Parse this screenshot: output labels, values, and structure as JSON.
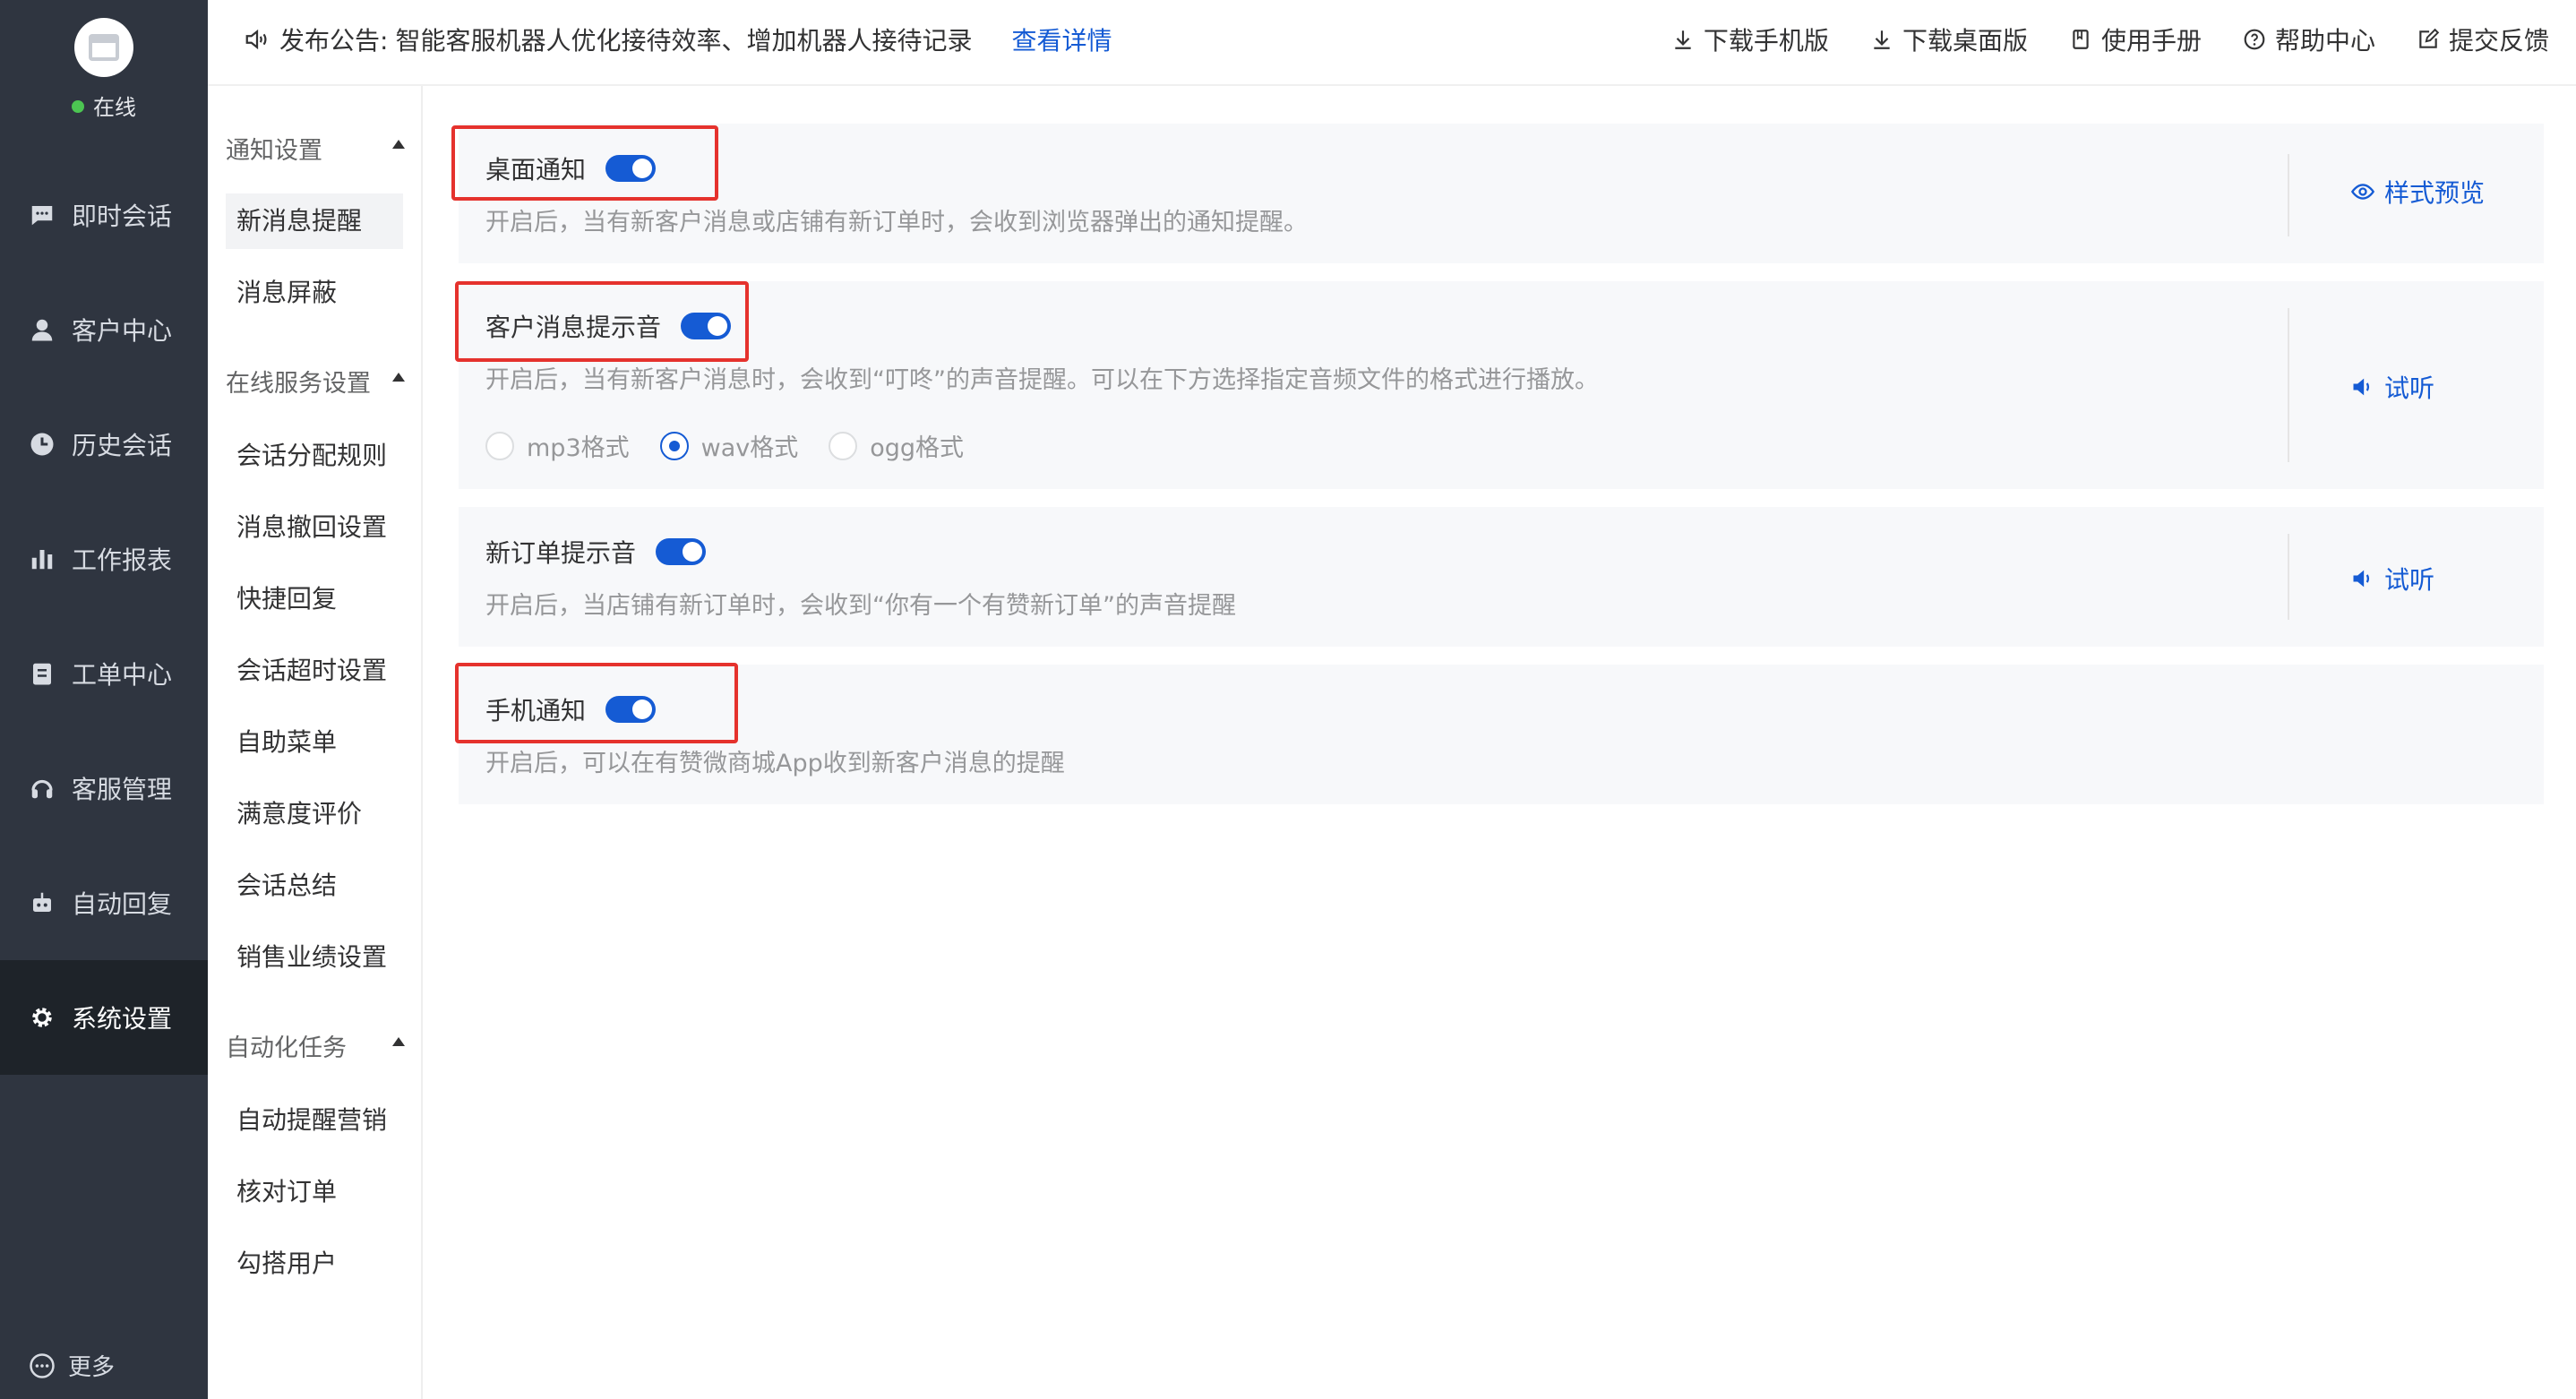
{
  "sidebar": {
    "status": "在线",
    "items": [
      {
        "label": "即时会话",
        "icon": "chat-icon",
        "active": false
      },
      {
        "label": "客户中心",
        "icon": "user-icon",
        "active": false
      },
      {
        "label": "历史会话",
        "icon": "clock-icon",
        "active": false
      },
      {
        "label": "工作报表",
        "icon": "bar-chart-icon",
        "active": false
      },
      {
        "label": "工单中心",
        "icon": "clipboard-icon",
        "active": false
      },
      {
        "label": "客服管理",
        "icon": "headset-icon",
        "active": false
      },
      {
        "label": "自动回复",
        "icon": "robot-icon",
        "active": false
      },
      {
        "label": "系统设置",
        "icon": "gear-icon",
        "active": true
      }
    ],
    "more": "更多"
  },
  "subnav": {
    "groups": [
      {
        "title": "通知设置",
        "items": [
          "新消息提醒",
          "消息屏蔽"
        ]
      },
      {
        "title": "在线服务设置",
        "items": [
          "会话分配规则",
          "消息撤回设置",
          "快捷回复",
          "会话超时设置",
          "自助菜单",
          "满意度评价",
          "会话总结",
          "销售业绩设置"
        ]
      },
      {
        "title": "自动化任务",
        "items": [
          "自动提醒营销",
          "核对订单",
          "勾搭用户"
        ]
      }
    ],
    "active": "新消息提醒"
  },
  "topbar": {
    "notice_prefix": "发布公告:",
    "notice_text": "智能客服机器人优化接待效率、增加机器人接待记录",
    "notice_link": "查看详情",
    "links": [
      {
        "label": "下载手机版",
        "icon": "download-icon"
      },
      {
        "label": "下载桌面版",
        "icon": "download-icon"
      },
      {
        "label": "使用手册",
        "icon": "book-icon"
      },
      {
        "label": "帮助中心",
        "icon": "help-circle-icon"
      },
      {
        "label": "提交反馈",
        "icon": "edit-icon"
      }
    ]
  },
  "cards": {
    "desktop": {
      "title": "桌面通知",
      "enabled": true,
      "desc": "开启后，当有新客户消息或店铺有新订单时，会收到浏览器弹出的通知提醒。",
      "action": "样式预览"
    },
    "sound": {
      "title": "客户消息提示音",
      "enabled": true,
      "desc": "开启后，当有新客户消息时，会收到“叮咚”的声音提醒。可以在下方选择指定音频文件的格式进行播放。",
      "formats": [
        "mp3格式",
        "wav格式",
        "ogg格式"
      ],
      "selected_format": "wav格式",
      "action": "试听"
    },
    "order": {
      "title": "新订单提示音",
      "enabled": true,
      "desc": "开启后，当店铺有新订单时，会收到“你有一个有赞新订单”的声音提醒",
      "action": "试听"
    },
    "mobile": {
      "title": "手机通知",
      "enabled": true,
      "desc": "开启后，可以在有赞微商城App收到新客户消息的提醒"
    }
  },
  "colors": {
    "sidebar_bg": "#2f3540",
    "active_bg": "#1e2329",
    "primary": "#155bd4",
    "online": "#4cc552",
    "highlight": "#e5322d"
  }
}
